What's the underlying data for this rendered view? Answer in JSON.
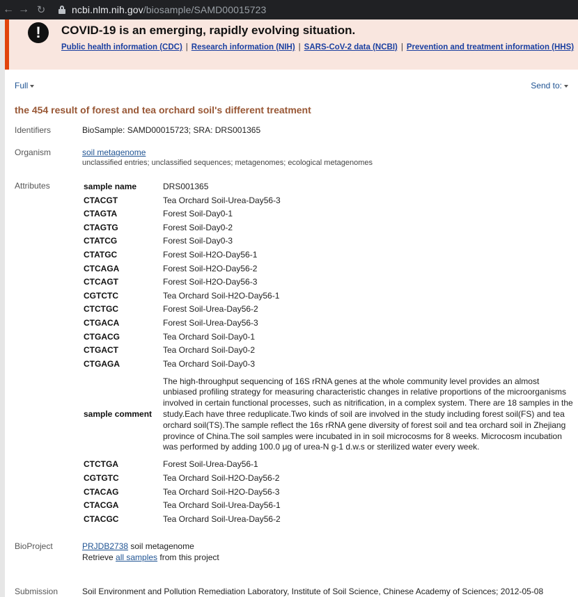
{
  "browser": {
    "url_domain": "ncbi.nlm.nih.gov",
    "url_path": "/biosample/SAMD00015723"
  },
  "banner": {
    "headline": "COVID-19 is an emerging, rapidly evolving situation.",
    "links": [
      "Public health information (CDC)",
      "Research information (NIH)",
      "SARS-CoV-2 data (NCBI)",
      "Prevention and treatment information (HHS)"
    ],
    "separator": "|"
  },
  "toolbar": {
    "format_label": "Full",
    "send_label": "Send to:"
  },
  "record": {
    "title": "the 454 result of forest and tea orchard soil's different treatment",
    "identifiers_label": "Identifiers",
    "identifiers_value": "BioSample: SAMD00015723; SRA: DRS001365",
    "organism_label": "Organism",
    "organism_link": "soil metagenome",
    "organism_lineage": "unclassified entries; unclassified sequences; metagenomes; ecological metagenomes",
    "attributes_label": "Attributes",
    "attributes": [
      {
        "key": "sample name",
        "value": "DRS001365"
      },
      {
        "key": "CTACGT",
        "value": "Tea Orchard Soil-Urea-Day56-3"
      },
      {
        "key": "CTAGTA",
        "value": "Forest Soil-Day0-1"
      },
      {
        "key": "CTAGTG",
        "value": "Forest Soil-Day0-2"
      },
      {
        "key": "CTATCG",
        "value": "Forest Soil-Day0-3"
      },
      {
        "key": "CTATGC",
        "value": "Forest Soil-H2O-Day56-1"
      },
      {
        "key": "CTCAGA",
        "value": "Forest Soil-H2O-Day56-2"
      },
      {
        "key": "CTCAGT",
        "value": "Forest Soil-H2O-Day56-3"
      },
      {
        "key": "CGTCTC",
        "value": "Tea Orchard Soil-H2O-Day56-1"
      },
      {
        "key": "CTCTGC",
        "value": "Forest Soil-Urea-Day56-2"
      },
      {
        "key": "CTGACA",
        "value": "Forest Soil-Urea-Day56-3"
      },
      {
        "key": "CTGACG",
        "value": "Tea Orchard Soil-Day0-1"
      },
      {
        "key": "CTGACT",
        "value": "Tea Orchard Soil-Day0-2"
      },
      {
        "key": "CTGAGA",
        "value": "Tea Orchard Soil-Day0-3"
      },
      {
        "key": "sample comment",
        "value": "The high-throughput sequencing of 16S rRNA genes at the whole community level provides an almost unbiased profiling strategy for measuring characteristic changes in relative proportions of the microorganisms involved in certain functional processes, such as nitrification, in a complex system. There are 18 samples in the study.Each have three reduplicate.Two kinds of soil are involved in the study including forest soil(FS) and tea orchard soil(TS).The sample reflect the 16s rRNA gene diversity of forest soil and tea orchard soil in Zhejiang province of China.The soil samples were incubated in in soil microcosms for 8 weeks. Microcosm incubation was performed by adding 100.0 μg of urea-N g-1 d.w.s or sterilized water every week."
      },
      {
        "key": "CTCTGA",
        "value": "Forest Soil-Urea-Day56-1"
      },
      {
        "key": "CGTGTC",
        "value": "Tea Orchard Soil-H2O-Day56-2"
      },
      {
        "key": "CTACAG",
        "value": "Tea Orchard Soil-H2O-Day56-3"
      },
      {
        "key": "CTACGA",
        "value": "Tea Orchard Soil-Urea-Day56-1"
      },
      {
        "key": "CTACGC",
        "value": "Tea Orchard Soil-Urea-Day56-2"
      }
    ],
    "bioproject_label": "BioProject",
    "bioproject_link": "PRJDB2738",
    "bioproject_name": " soil metagenome",
    "retrieve_prefix": "Retrieve ",
    "retrieve_link": "all samples",
    "retrieve_suffix": " from this project",
    "submission_label": "Submission",
    "submission_value": "Soil Environment and Pollution Remediation Laboratory, Institute of Soil Science, Chinese Academy of Sciences; 2012-05-08"
  }
}
